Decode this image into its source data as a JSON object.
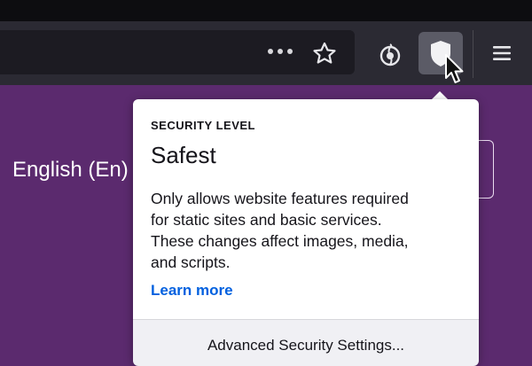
{
  "toolbar": {
    "page_actions_icon": "ellipsis-icon",
    "bookmark_icon": "star-icon",
    "onion_icon": "onion-icon",
    "security_icon": "shield-icon",
    "menu_icon": "hamburger-menu-icon"
  },
  "page": {
    "language_label": "English (En)"
  },
  "security_popup": {
    "heading": "SECURITY LEVEL",
    "level": "Safest",
    "description_lines": [
      "Only allows website features required",
      "for static sites and basic services.",
      "These changes affect images, media,",
      "and scripts."
    ],
    "learn_more": "Learn more",
    "advanced_button": "Advanced Security Settings..."
  },
  "colors": {
    "page_background": "#5b2a6e",
    "toolbar": "#2b2a33",
    "link": "#0060df"
  }
}
